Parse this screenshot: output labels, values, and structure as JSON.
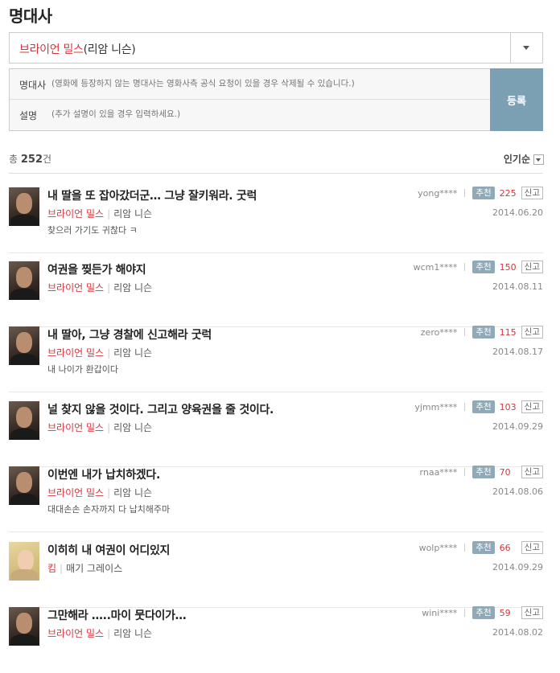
{
  "header": {
    "title": "명대사"
  },
  "selector": {
    "character": "브라이언 밀스",
    "actor": "(리암 니슨)"
  },
  "form": {
    "quote_label": "명대사",
    "quote_placeholder": "(영화에 등장하지 않는 명대사는 영화사측 공식 요청이 있을 경우 삭제될 수 있습니다.)",
    "desc_label": "설명",
    "desc_placeholder": "(추가 설명이 있을 경우 입력하세요.)",
    "submit_label": "등록"
  },
  "summary": {
    "prefix": "총",
    "count": "252",
    "suffix": "건",
    "sort_label": "인기순"
  },
  "labels": {
    "recommend": "추천",
    "report": "신고"
  },
  "items": [
    {
      "quote": "내 딸을 또 잡아갔더군… 그냥 잘키워라. 굿럭",
      "character": "브라이언 밀스",
      "actor": "리암 니슨",
      "desc": "찾으러 가기도 귀찮다 ㅋ",
      "user": "yong****",
      "likes": "225",
      "date": "2014.06.20",
      "avatar": "man"
    },
    {
      "quote": "여권을 찢든가 해야지",
      "character": "브라이언 밀스",
      "actor": "리암 니슨",
      "desc": "",
      "user": "wcm1****",
      "likes": "150",
      "date": "2014.08.11",
      "avatar": "man"
    },
    {
      "quote": "내 딸아, 그냥 경찰에 신고해라 굿럭",
      "character": "브라이언 밀스",
      "actor": "리암 니슨",
      "desc": "내 나이가 환갑이다",
      "user": "zero****",
      "likes": "115",
      "date": "2014.08.17",
      "avatar": "man"
    },
    {
      "quote": "널 찾지 않을 것이다. 그리고 양육권을 줄 것이다.",
      "character": "브라이언 밀스",
      "actor": "리암 니슨",
      "desc": "",
      "user": "yjmm****",
      "likes": "103",
      "date": "2014.09.29",
      "avatar": "man"
    },
    {
      "quote": "이번엔 내가 납치하겠다.",
      "character": "브라이언 밀스",
      "actor": "리암 니슨",
      "desc": "대대손손 손자까지 다 납치해주마",
      "user": "rnaa****",
      "likes": "70",
      "date": "2014.08.06",
      "avatar": "man"
    },
    {
      "quote": "이히히 내 여권이 어디있지",
      "character": "킴",
      "actor": "매기 그레이스",
      "desc": "",
      "user": "wolp****",
      "likes": "66",
      "date": "2014.09.29",
      "avatar": "woman"
    },
    {
      "quote": "그만해라 …..마이 뭇다이가…",
      "character": "브라이언 밀스",
      "actor": "리암 니슨",
      "desc": "",
      "user": "wini****",
      "likes": "59",
      "date": "2014.08.02",
      "avatar": "man"
    }
  ]
}
